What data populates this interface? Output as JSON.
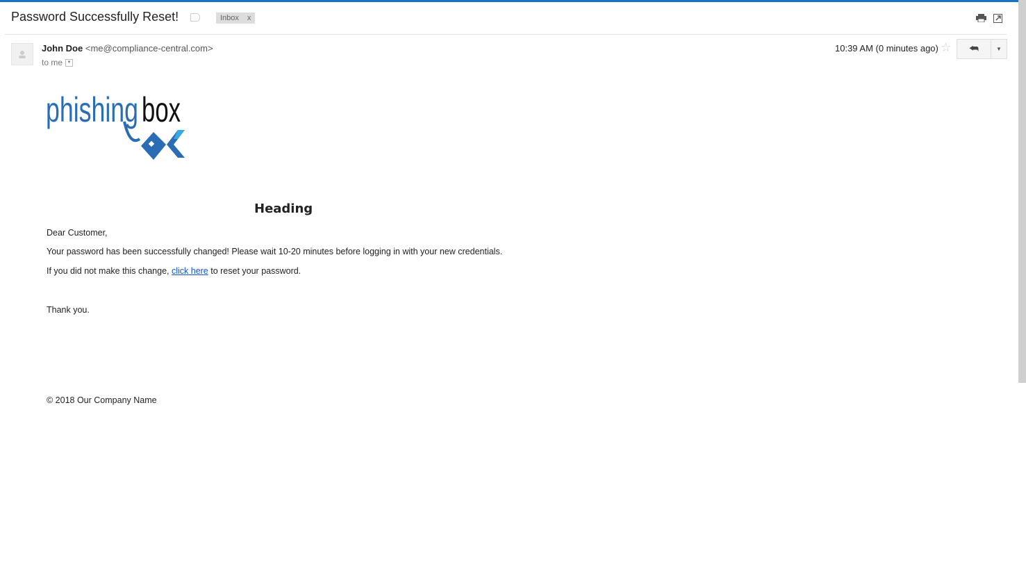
{
  "email": {
    "subject": "Password Successfully Reset!",
    "label": "Inbox",
    "label_remove": "x",
    "sender_name": "John Doe",
    "sender_email": "<me@compliance-central.com>",
    "to": "to me",
    "time": "10:39 AM (0 minutes ago)"
  },
  "body": {
    "logo_text": "phishingbox",
    "heading": "Heading",
    "greeting": "Dear Customer,",
    "line1": "Your password has been successfully changed! Please wait 10-20 minutes before logging in with your new credentials.",
    "line2_pre": "If you did not make this change, ",
    "link": "click here",
    "line2_post": " to reset your password.",
    "thanks": "Thank you.",
    "footer": "© 2018 Our Company Name"
  }
}
